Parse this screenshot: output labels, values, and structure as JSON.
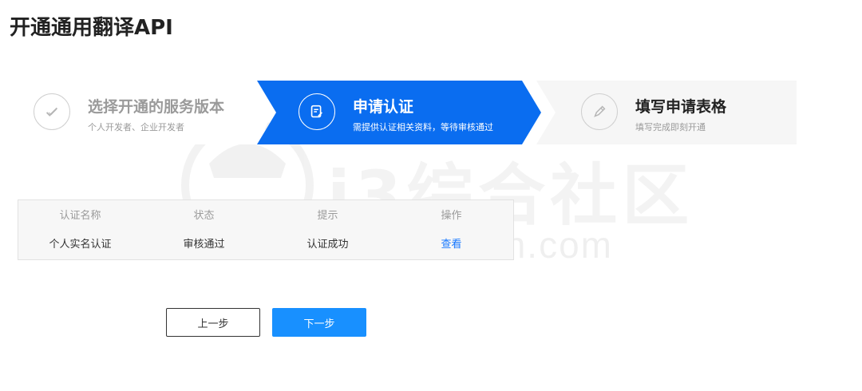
{
  "page": {
    "title": "开通通用翻译API"
  },
  "colors": {
    "accent": "#1677ff",
    "step_active_bg": "#0a6df0",
    "step_inactive_bg": "#f6f6f6"
  },
  "steps": [
    {
      "title": "选择开通的服务版本",
      "subtitle": "个人开发者、企业开发者",
      "status": "done",
      "icon": "check-icon"
    },
    {
      "title": "申请认证",
      "subtitle": "需提供认证相关资料，等待审核通过",
      "status": "active",
      "icon": "document-edit-icon"
    },
    {
      "title": "填写申请表格",
      "subtitle": "填写完成即刻开通",
      "status": "pending",
      "icon": "pencil-icon"
    }
  ],
  "table": {
    "headers": [
      "认证名称",
      "状态",
      "提示",
      "操作"
    ],
    "rows": [
      {
        "name": "个人实名认证",
        "status": "审核通过",
        "hint": "认证成功",
        "action": "查看"
      }
    ]
  },
  "buttons": {
    "prev": "上一步",
    "next": "下一步"
  },
  "watermark": {
    "text": "i3综合社区",
    "url": "www.i3zh.com"
  }
}
